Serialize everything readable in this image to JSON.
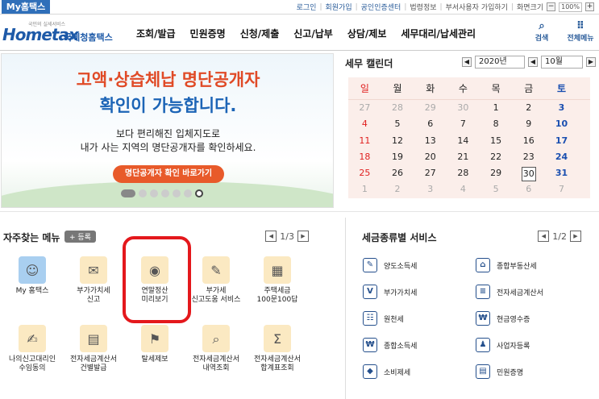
{
  "topbar": {
    "my_tab": "My홈택스",
    "links": [
      "로그인",
      "회원가입",
      "공인인증센터",
      "법령정보",
      "부서사용자 가입하기",
      "화면크기"
    ],
    "zoom": "100%"
  },
  "header": {
    "logo_small": "국민의 실세서비스",
    "logo_main": "Hometax",
    "logo_kr": "국세청홈택스",
    "nav": [
      "조회/발급",
      "민원증명",
      "신청/제출",
      "신고/납부",
      "상담/제보",
      "세무대리/납세관리"
    ],
    "search_label": "검색",
    "menu_label": "전체메뉴"
  },
  "banner": {
    "line1": "고액·상습체납 명단공개자",
    "line2": "확인이 가능합니다.",
    "line3": "보다 편리해진 입체지도로",
    "line4": "내가 사는 지역의 명단공개자를 확인하세요.",
    "button": "명단공개자 확인 바로가기"
  },
  "calendar": {
    "title": "세무 캘린더",
    "year": "2020년",
    "month": "10월",
    "days": [
      "일",
      "월",
      "화",
      "수",
      "목",
      "금",
      "토"
    ],
    "rows": [
      [
        "27",
        "28",
        "29",
        "30",
        "1",
        "2",
        "3"
      ],
      [
        "4",
        "5",
        "6",
        "7",
        "8",
        "9",
        "10"
      ],
      [
        "11",
        "12",
        "13",
        "14",
        "15",
        "16",
        "17"
      ],
      [
        "18",
        "19",
        "20",
        "21",
        "22",
        "23",
        "24"
      ],
      [
        "25",
        "26",
        "27",
        "28",
        "29",
        "30",
        "31"
      ],
      [
        "1",
        "2",
        "3",
        "4",
        "5",
        "6",
        "7"
      ]
    ]
  },
  "favorites": {
    "title": "자주찾는 메뉴",
    "register": "등록",
    "page": "1/3",
    "items": [
      {
        "label": "My 홈택스",
        "icon": "person-icon"
      },
      {
        "label": "부가가치세\n신고",
        "icon": "vat-report-icon"
      },
      {
        "label": "연말정산\n미리보기",
        "icon": "money-bag-icon"
      },
      {
        "label": "부가세\n신고도움 서비스",
        "icon": "vat-help-icon"
      },
      {
        "label": "주택세금\n100문100답",
        "icon": "building-icon"
      },
      {
        "label": "나의신고대리인\n수임동의",
        "icon": "agent-icon"
      },
      {
        "label": "전자세금계산서\n건별발급",
        "icon": "einvoice-icon"
      },
      {
        "label": "탈세제보",
        "icon": "tax-report-icon"
      },
      {
        "label": "전자세금계산서\n내역조회",
        "icon": "invoice-search-icon"
      },
      {
        "label": "전자세금계산서\n합계표조회",
        "icon": "invoice-sum-icon"
      }
    ]
  },
  "tax_services": {
    "title": "세금종류별 서비스",
    "page": "1/2",
    "items": [
      {
        "label": "양도소득세",
        "glyph": "✎"
      },
      {
        "label": "종합부동산세",
        "glyph": "⌂"
      },
      {
        "label": "부가가치세",
        "glyph": "V"
      },
      {
        "label": "전자세금계산서",
        "glyph": "≡"
      },
      {
        "label": "원천세",
        "glyph": "☷"
      },
      {
        "label": "현금영수증",
        "glyph": "₩"
      },
      {
        "label": "종합소득세",
        "glyph": "₩"
      },
      {
        "label": "사업자등록",
        "glyph": "♟"
      },
      {
        "label": "소비제세",
        "glyph": "◆"
      },
      {
        "label": "민원증명",
        "glyph": "▤"
      }
    ]
  }
}
